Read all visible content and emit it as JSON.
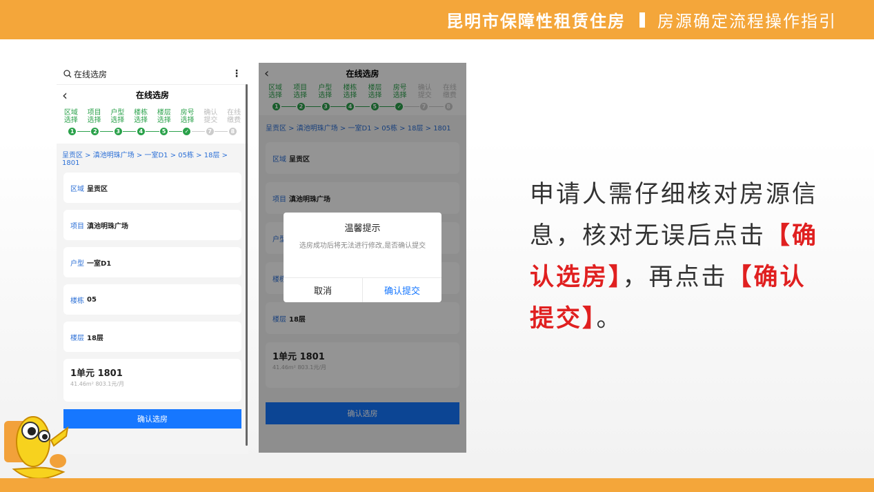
{
  "header": {
    "main": "昆明市保障性租赁住房",
    "sub": "房源确定流程操作指引"
  },
  "steps": [
    {
      "line1": "区域",
      "line2": "选择",
      "num": "1",
      "done": true
    },
    {
      "line1": "项目",
      "line2": "选择",
      "num": "2",
      "done": true
    },
    {
      "line1": "户型",
      "line2": "选择",
      "num": "3",
      "done": true
    },
    {
      "line1": "楼栋",
      "line2": "选择",
      "num": "4",
      "done": true
    },
    {
      "line1": "楼层",
      "line2": "选择",
      "num": "5",
      "done": true
    },
    {
      "line1": "房号",
      "line2": "选择",
      "num": "✓",
      "done": true
    },
    {
      "line1": "确认",
      "line2": "提交",
      "num": "7",
      "done": false
    },
    {
      "line1": "在线",
      "line2": "缴费",
      "num": "8",
      "done": false
    }
  ],
  "left_phone": {
    "search_text": "在线选房",
    "title": "在线选房",
    "breadcrumb": "呈贡区 > 滇池明珠广场 > 一室D1 > 05栋 > 18层 > 1801",
    "fields": [
      {
        "k": "区域",
        "v": "呈贡区"
      },
      {
        "k": "项目",
        "v": "滇池明珠广场"
      },
      {
        "k": "户型",
        "v": "一室D1"
      },
      {
        "k": "楼栋",
        "v": "05"
      },
      {
        "k": "楼层",
        "v": "18层"
      }
    ],
    "unit_title": "1单元 1801",
    "unit_sub": "41.46m² 803.1元/月",
    "confirm_label": "确认选房"
  },
  "right_phone": {
    "title": "在线选房",
    "breadcrumb": "呈贡区 > 滇池明珠广场 > 一室D1 > 05栋 > 18层 > 1801",
    "fields": [
      {
        "k": "区域",
        "v": "呈贡区"
      },
      {
        "k": "项目",
        "v": "滇池明珠广场"
      },
      {
        "k": "户型",
        "v": ""
      },
      {
        "k": "楼栋",
        "v": ""
      },
      {
        "k": "楼层",
        "v": "18层"
      }
    ],
    "unit_title": "1单元 1801",
    "unit_sub": "41.46m² 803.1元/月",
    "confirm_label": "确认选房",
    "dialog": {
      "title": "温馨提示",
      "message": "选房成功后将无法进行修改,是否确认提交",
      "cancel": "取消",
      "ok": "确认提交"
    }
  },
  "description": {
    "line1": "申请人需仔细核对房源信息，核对无误后点击",
    "btn1": "【确认选房】",
    "mid": "，再点击",
    "btn2": "【确认提交】",
    "end": "。"
  },
  "colors": {
    "accent": "#f4a63a",
    "primary": "#1677ff",
    "success": "#2aa14a",
    "emphasis": "#e02020"
  }
}
